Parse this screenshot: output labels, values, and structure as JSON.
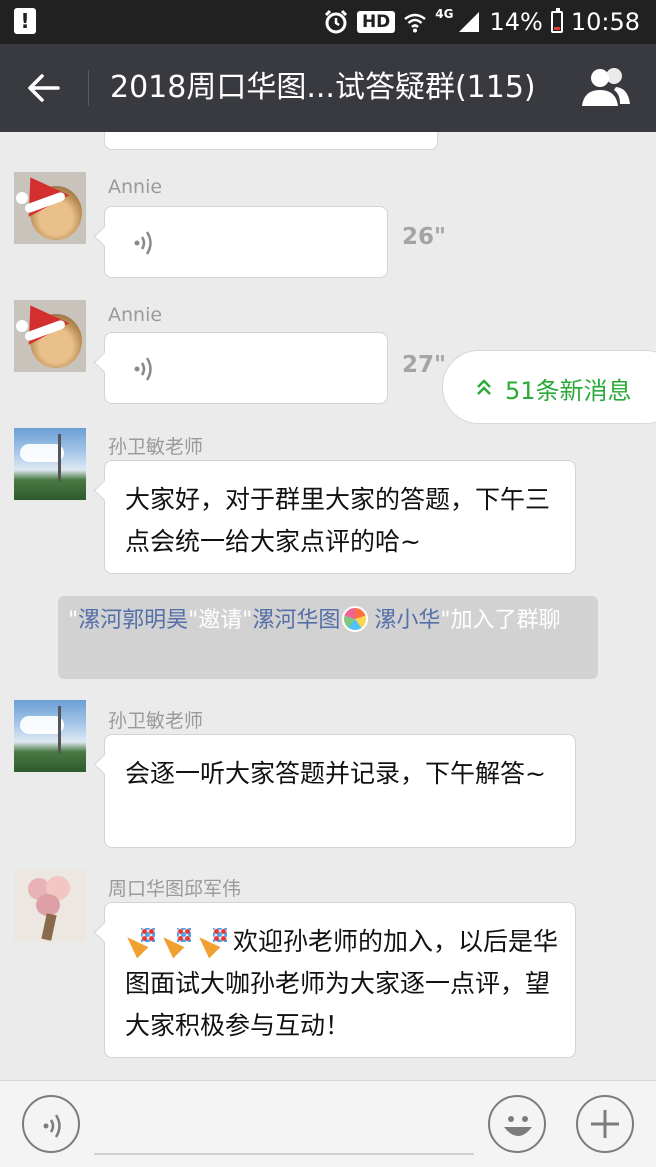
{
  "status_bar": {
    "hd": "HD",
    "network": "4G",
    "battery": "14%",
    "time": "10:58"
  },
  "header": {
    "title": "2018周口华图...试答疑群(115)"
  },
  "messages": [
    {
      "sender": "Annie",
      "type": "voice",
      "duration": "26\""
    },
    {
      "sender": "Annie",
      "type": "voice",
      "duration": "27\"",
      "unread": true
    },
    {
      "sender": "孙卫敏老师",
      "type": "text",
      "text": "大家好，对于群里大家的答题，下午三点会统一给大家点评的哈~"
    },
    {
      "type": "system",
      "quote1": "\"",
      "inviter": "漯河郭明昊",
      "mid": "\"邀请\"",
      "invitee1": "漯河华图",
      "invitee2": "漯小华",
      "tail": "\"加入了群聊"
    },
    {
      "sender": "孙卫敏老师",
      "type": "text",
      "text": "会逐一听大家答题并记录，下午解答~"
    },
    {
      "sender": "周口华图邱军伟",
      "type": "text",
      "text": "欢迎孙老师的加入，以后是华图面试大咖孙老师为大家逐一点评，望大家积极参与互动！"
    }
  ],
  "new_messages_pill": {
    "label": "51条新消息"
  },
  "colors": {
    "title_bar": "#393a3f",
    "status_bar": "#212121",
    "chat_bg": "#ebebeb",
    "link": "#556fa8",
    "new_msg": "#2aaa38",
    "unread_dot": "#f23f3f"
  }
}
